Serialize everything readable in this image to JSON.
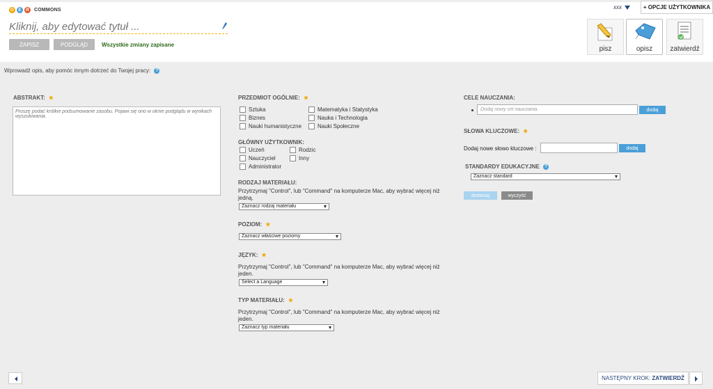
{
  "header": {
    "logo_letters": [
      "O",
      "E",
      "R"
    ],
    "logo_word": "COMMONS",
    "title_placeholder": "Kliknij, aby edytować tytuł ...",
    "save_label": "ZAPISZ",
    "preview_label": "PODGLĄD",
    "saved_status": "Wszystkie zmiany zapisane",
    "user_name": "xxx",
    "user_options": "+ OPCJE UŻYTKOWNIKA",
    "steps": [
      {
        "label": "pisz",
        "icon": "pencil-icon"
      },
      {
        "label": "opisz",
        "icon": "tag-icon"
      },
      {
        "label": "zatwierdź",
        "icon": "checklist-icon"
      }
    ]
  },
  "subtitle": "Wprowadź opis, aby pomóc innym dotrzeć do Twojej pracy:",
  "abstract": {
    "label": "ABSTRAKT:",
    "placeholder": "Proszę podać krótkie podsumowanie zasobu. Pojawi się ono w oknie podglądu w wynikach wyszukiwania."
  },
  "subject": {
    "label": "PRZEDMIOT OGÓLNIE:",
    "options": [
      "Sztuka",
      "Biznes",
      "Nauki humanistyczne",
      "Matematyka i Statystyka",
      "Nauka i Technologia",
      "Nauki Społeczne"
    ]
  },
  "audience": {
    "label": "GŁÓWNY UŻYTKOWNIK:",
    "options": [
      "Uczeń",
      "Nauczyciel",
      "Administrator",
      "Rodzic",
      "Inny"
    ]
  },
  "material_kind": {
    "label": "RODZAJ MATERIAŁU:",
    "hint": "Przytrzymaj \"Control\", lub \"Command\" na komputerze Mac, aby wybrać więcej niż jedną.",
    "select": "Zaznacz rodzaj materiału"
  },
  "level": {
    "label": "POZIOM:",
    "select": "Zaznacz właściwe poziomy"
  },
  "language": {
    "label": "JĘZYK:",
    "hint": "Przytrzymaj \"Control\", lub \"Command\" na komputerze Mac, aby wybrać więcej niż jeden.",
    "select": "Select a Language"
  },
  "material_type": {
    "label": "TYP MATERIAŁU:",
    "hint": "Przytrzymaj \"Control\", lub \"Command\" na komputerze Mac, aby wybrać więcej niż jeden.",
    "select": "Zaznacz typ materiału"
  },
  "goals": {
    "label": "CELE NAUCZANIA:",
    "placeholder": "Dodaj nowy cel nauczania.",
    "add_label": "dodaj"
  },
  "keywords": {
    "label": "SŁOWA KLUCZOWE:",
    "input_label": "Dodaj nowe słowo kluczowe :",
    "add_label": "dodaj"
  },
  "standards": {
    "label": "STANDARDY EDUKACYJNE",
    "select": "Zaznacz standard",
    "apply_label": "dostosuj",
    "clear_label": "wyczyść"
  },
  "footer": {
    "next_prefix": "NASTĘPNY KROK:",
    "next_step": "ZATWIERDŹ"
  },
  "colors": {
    "accent": "#4a9fd8",
    "star": "#f0a500",
    "saved": "#2d6b1a",
    "logo": [
      "#f0a500",
      "#4a9fd8",
      "#e05a2b"
    ]
  }
}
